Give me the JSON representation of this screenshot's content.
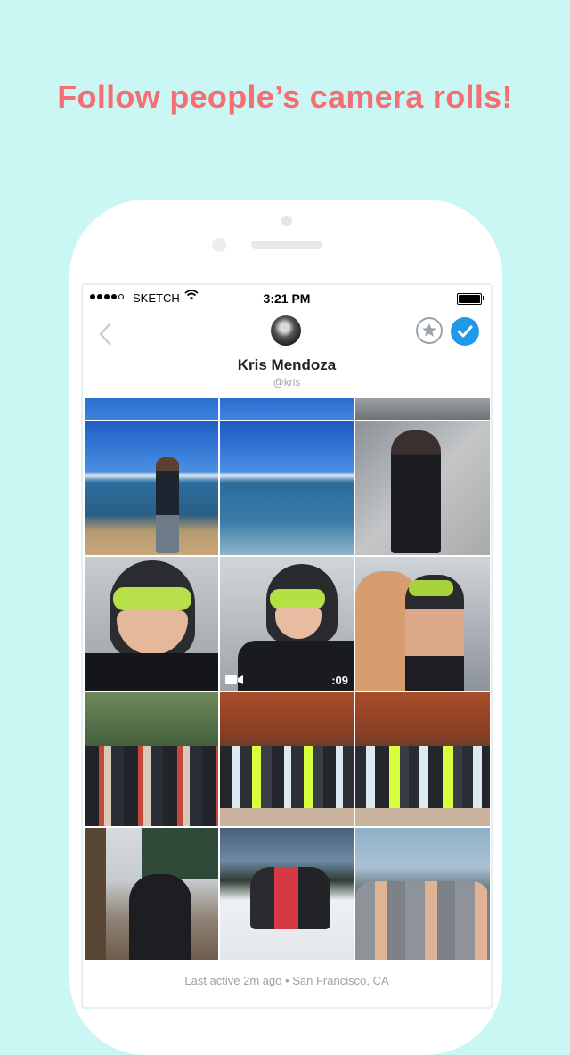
{
  "headline": "Follow people’s camera rolls!",
  "status_bar": {
    "carrier": "SKETCH",
    "time": "3:21 PM"
  },
  "profile": {
    "name": "Kris Mendoza",
    "handle": "@kris"
  },
  "grid": {
    "video": {
      "duration": ":09"
    }
  },
  "footer": {
    "last_active": "Last active 2m ago • San Francisco, CA"
  },
  "colors": {
    "background": "#caf6f4",
    "headline": "#f76d74",
    "accent": "#1e9ae8"
  },
  "icons": [
    "back-chevron-icon",
    "star-icon",
    "check-icon",
    "wifi-icon",
    "video-camera-icon",
    "battery-icon"
  ]
}
